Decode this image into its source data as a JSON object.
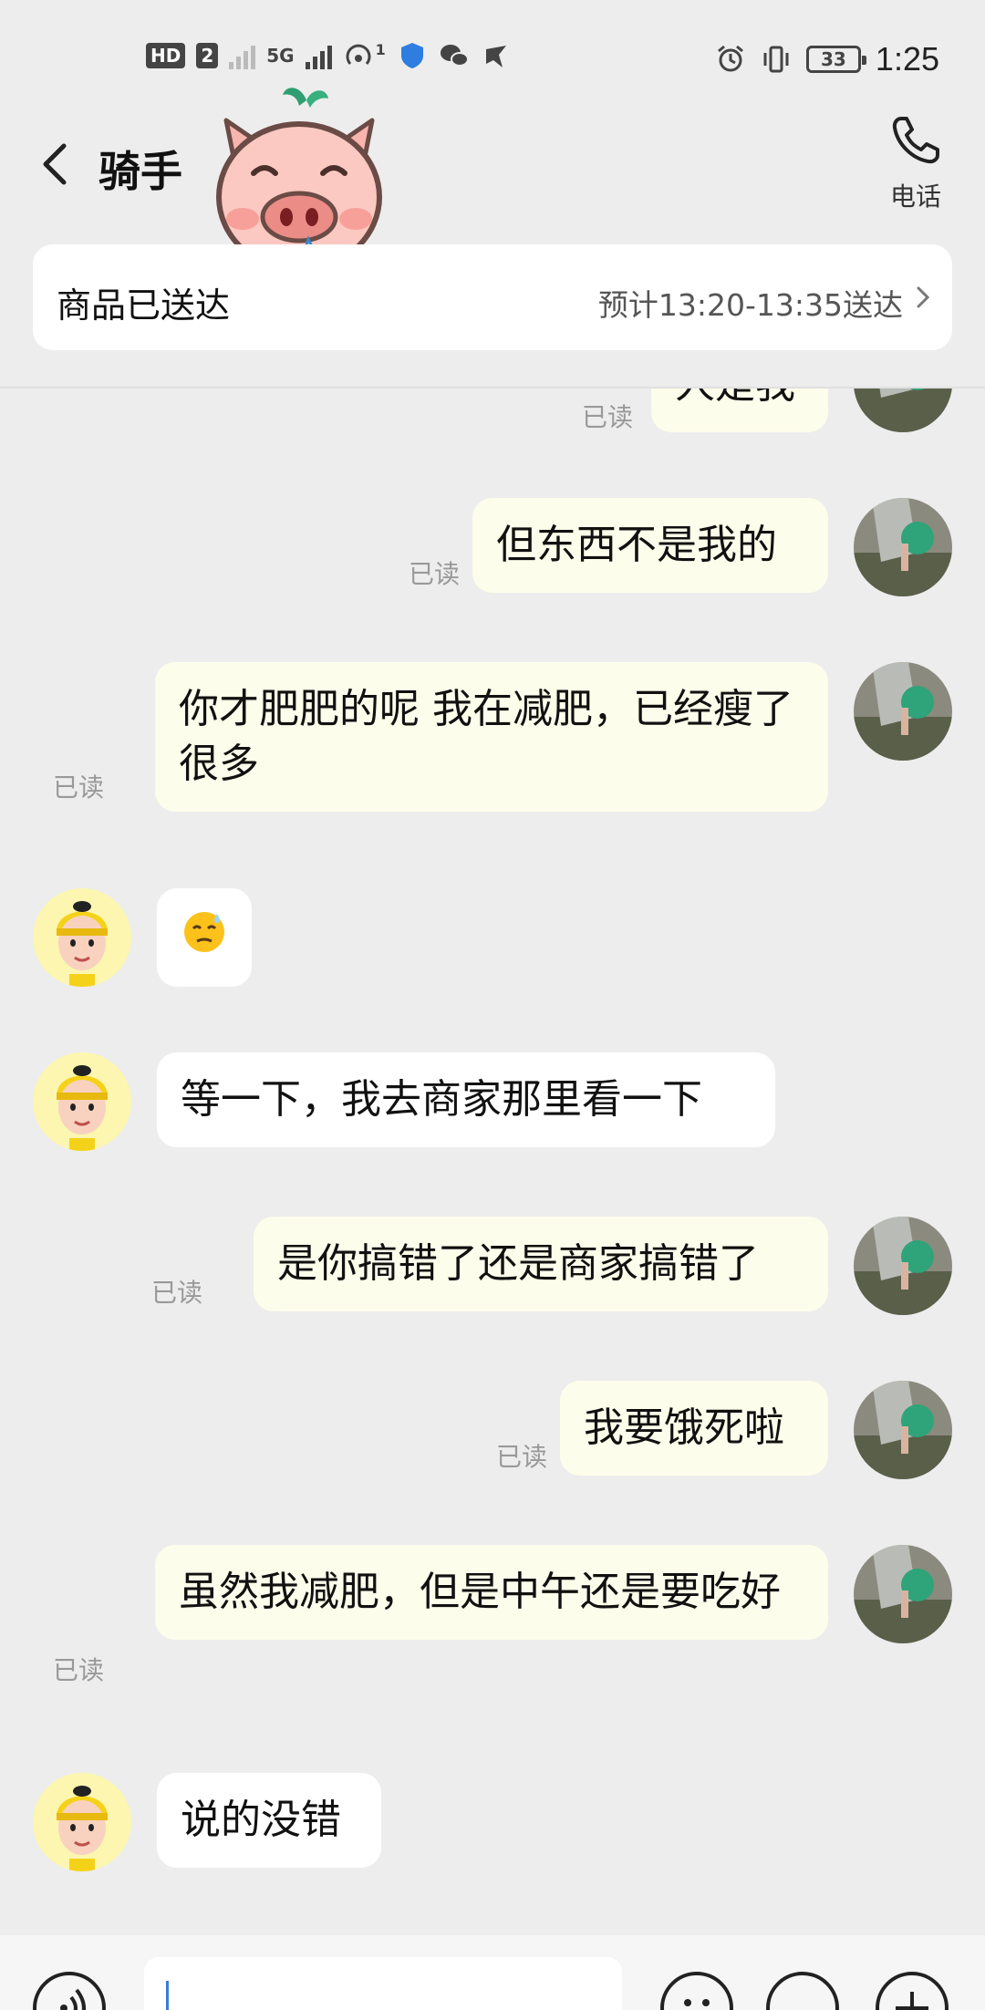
{
  "status_bar": {
    "hd": "HD",
    "sim": "2",
    "network": "5G",
    "hotspot_count": "1",
    "battery": "33",
    "time": "1:25"
  },
  "header": {
    "title": "骑手",
    "phone_label": "电话"
  },
  "delivery": {
    "status": "商品已送达",
    "eta": "预计13:20-13:35送达"
  },
  "read_label": "已读",
  "messages": [
    {
      "side": "self",
      "text": "人是我",
      "read": true
    },
    {
      "side": "self",
      "text": "但东西不是我的",
      "read": true
    },
    {
      "side": "self",
      "text": "你才肥肥的呢 我在减肥，已经瘦了很多",
      "read": true
    },
    {
      "side": "other",
      "emoji": "sweat-face-emoji"
    },
    {
      "side": "other",
      "text": "等一下，我去商家那里看一下"
    },
    {
      "side": "self",
      "text": "是你搞错了还是商家搞错了",
      "read": true
    },
    {
      "side": "self",
      "text": "我要饿死啦",
      "read": true
    },
    {
      "side": "self",
      "text": "虽然我减肥，但是中午还是要吃好",
      "read": true
    },
    {
      "side": "other",
      "text": "说的没错"
    }
  ],
  "colors": {
    "background": "#ededed",
    "self_bubble": "#fdfdeb",
    "other_bubble": "#ffffff",
    "read_text": "#999999",
    "rider_avatar_bg": "#fcf6b0",
    "helmet": "#f5d21a"
  },
  "icons": [
    "back-arrow-icon",
    "phone-icon",
    "chevron-right-icon",
    "voice-icon",
    "emoji-icon",
    "plus-icon",
    "pig-sticker"
  ]
}
